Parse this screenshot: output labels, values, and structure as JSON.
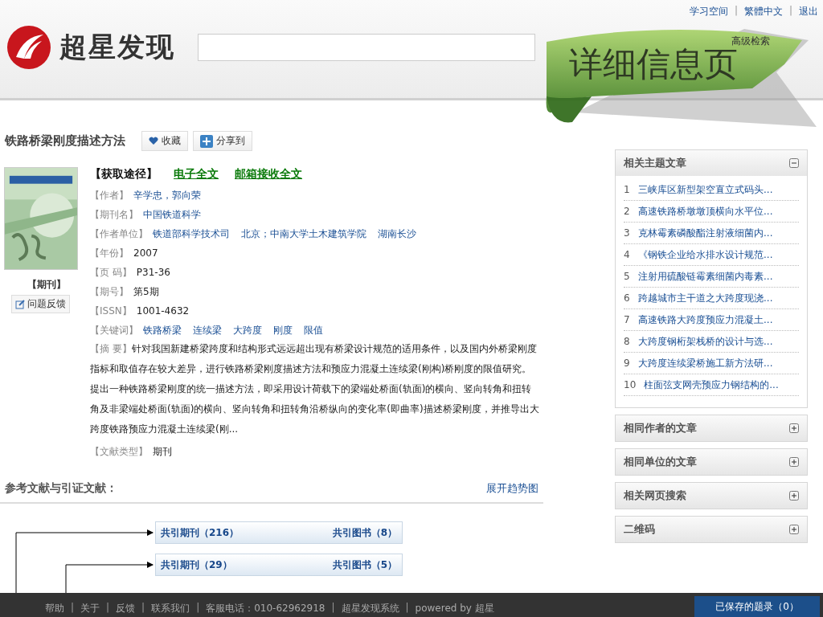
{
  "top_links": [
    "学习空间",
    "繁體中文",
    "退出"
  ],
  "link_separator": "|",
  "logo": {
    "text": "超星发现"
  },
  "search": {
    "advanced_link": "高级检索"
  },
  "ribbon": {
    "text": "详细信息页"
  },
  "article": {
    "title": "铁路桥梁刚度描述方法",
    "actions": [
      {
        "kind": "favorite",
        "label": "收藏"
      },
      {
        "kind": "share",
        "label": "分享到"
      }
    ],
    "type_label": "【期刊】",
    "feedback": "问题反馈",
    "access": {
      "label": "【获取途径】",
      "links": [
        "电子全文",
        "邮箱接收全文"
      ]
    },
    "fields": [
      {
        "label": "【作者】",
        "kind": "link",
        "values": [
          "辛学忠，郭向荣"
        ]
      },
      {
        "label": "【期刊名】",
        "kind": "link",
        "values": [
          "中国铁道科学"
        ]
      },
      {
        "label": "【作者单位】",
        "kind": "link",
        "values": [
          "铁道部科学技术司",
          "北京；中南大学土木建筑学院",
          "湖南长沙"
        ]
      },
      {
        "label": "【年份】",
        "kind": "plain",
        "values": [
          "2007"
        ]
      },
      {
        "label": "【页 码】",
        "kind": "plain",
        "values": [
          "P31-36"
        ]
      },
      {
        "label": "【期号】",
        "kind": "plain",
        "values": [
          "第5期"
        ]
      },
      {
        "label": "【ISSN】",
        "kind": "plain",
        "values": [
          "1001-4632"
        ]
      },
      {
        "label": "【关键词】",
        "kind": "link",
        "values": [
          "铁路桥梁",
          "连续梁",
          "大跨度",
          "刚度",
          "限值"
        ]
      },
      {
        "label": "【摘 要】",
        "kind": "abstract",
        "values": [
          "针对我国新建桥梁跨度和结构形式远远超出现有桥梁设计规范的适用条件，以及国内外桥梁刚度指标和取值存在较大差异，进行铁路桥梁刚度描述方法和预应力混凝土连续梁(刚构)桥刚度的限值研究。提出一种铁路桥梁刚度的统一描述方法，即采用设计荷载下的梁端处桥面(轨面)的横向、竖向转角和扭转角及非梁端处桥面(轨面)的横向、竖向转角和扭转角沿桥纵向的变化率(即曲率)描述桥梁刚度，并推导出大跨度铁路预应力混凝土连续梁(刚..."
        ]
      },
      {
        "label": "【文献类型】",
        "kind": "plain",
        "values": [
          "期刊"
        ]
      }
    ]
  },
  "citations": {
    "title": "参考文献与引证文献：",
    "trend_link": "展开趋势图",
    "rows": [
      {
        "journals": "共引期刊（216）",
        "books": "共引图书（8）"
      },
      {
        "journals": "共引期刊（29）",
        "books": "共引图书（5）"
      }
    ]
  },
  "sidebar": {
    "panels": [
      {
        "title": "相关主题文章",
        "expanded": true,
        "items": [
          {
            "number": "1",
            "title": "三峡库区新型架空直立式码头..."
          },
          {
            "number": "2",
            "title": "高速铁路桥墩墩顶横向水平位..."
          },
          {
            "number": "3",
            "title": "克林霉素磷酸酯注射液细菌内..."
          },
          {
            "number": "4",
            "title": "《钢铁企业给水排水设计规范..."
          },
          {
            "number": "5",
            "title": "注射用硫酸链霉素细菌内毒素..."
          },
          {
            "number": "6",
            "title": "跨越城市主干道之大跨度现浇..."
          },
          {
            "number": "7",
            "title": "高速铁路大跨度预应力混凝土..."
          },
          {
            "number": "8",
            "title": "大跨度钢桁架栈桥的设计与选..."
          },
          {
            "number": "9",
            "title": "大跨度连续梁桥施工新方法研..."
          },
          {
            "number": "10",
            "title": "柱面弦支网壳预应力钢结构的..."
          }
        ]
      },
      {
        "title": "相同作者的文章",
        "expanded": false
      },
      {
        "title": "相同单位的文章",
        "expanded": false
      },
      {
        "title": "相关网页搜索",
        "expanded": false
      },
      {
        "title": "二维码",
        "expanded": false
      }
    ]
  },
  "footer": {
    "links": [
      "帮助",
      "关于",
      "反馈",
      "联系我们",
      "客服电话：010-62962918",
      "超星发现系统",
      "powered by 超星"
    ],
    "saved_button": "已保存的题录（0）"
  }
}
